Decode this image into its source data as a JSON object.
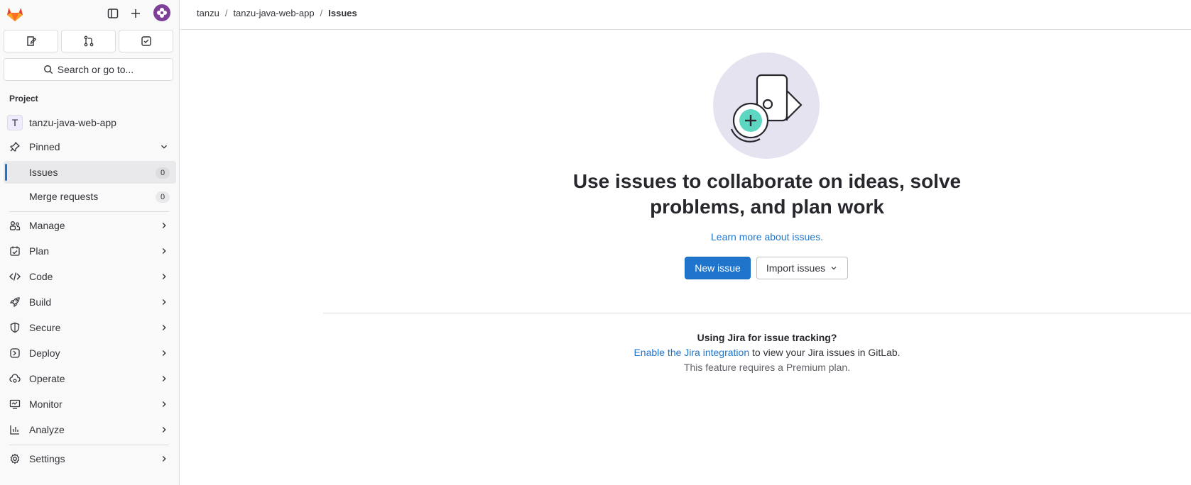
{
  "breadcrumb": [
    "tanzu",
    "tanzu-java-web-app",
    "Issues"
  ],
  "sidebar": {
    "search_label": "Search or go to...",
    "section_label": "Project",
    "project_initial": "T",
    "project_name": "tanzu-java-web-app",
    "pinned_label": "Pinned",
    "pinned_items": [
      {
        "label": "Issues",
        "count": "0"
      },
      {
        "label": "Merge requests",
        "count": "0"
      }
    ],
    "menu": [
      "Manage",
      "Plan",
      "Code",
      "Build",
      "Secure",
      "Deploy",
      "Operate",
      "Monitor",
      "Analyze"
    ],
    "settings_label": "Settings"
  },
  "empty_state": {
    "headline_line1": "Use issues to collaborate on ideas, solve",
    "headline_line2": "problems, and plan work",
    "learn_more": "Learn more about issues.",
    "new_issue": "New issue",
    "import_issues": "Import issues"
  },
  "jira": {
    "title": "Using Jira for issue tracking?",
    "link": "Enable the Jira integration",
    "rest": " to view your Jira issues in GitLab.",
    "note": "This feature requires a Premium plan."
  },
  "colors": {
    "accent": "#1f75cb",
    "brand": "#e24329",
    "illustration_bg": "#e5e3ef",
    "illustration_plus": "#5dd6c2"
  }
}
